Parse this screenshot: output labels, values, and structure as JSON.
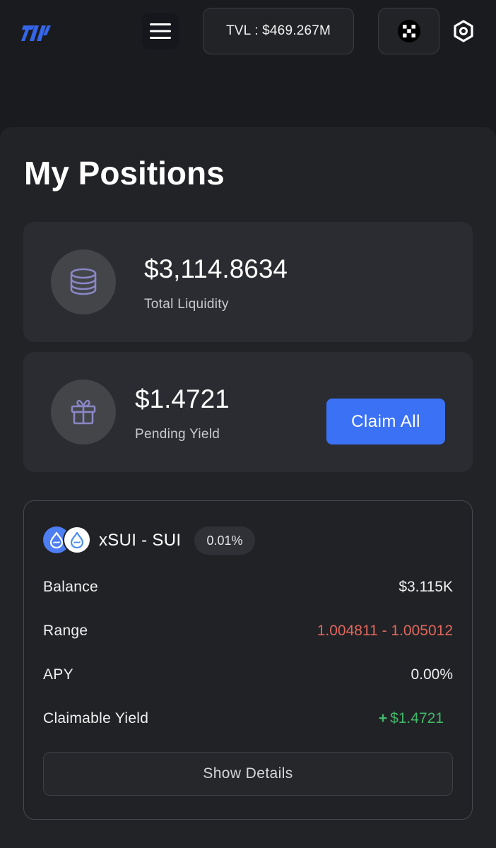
{
  "header": {
    "tvl_label": "TVL : $469.267M"
  },
  "page": {
    "title": "My Positions"
  },
  "liquidity_card": {
    "value": "$3,114.8634",
    "label": "Total Liquidity",
    "icon": "coins-stack-icon"
  },
  "yield_card": {
    "value": "$1.4721",
    "label": "Pending Yield",
    "icon": "gift-icon",
    "claim_label": "Claim All"
  },
  "position": {
    "pair_name": "xSUI - SUI",
    "fee": "0.01%",
    "rows": [
      {
        "label": "Balance",
        "value": "$3.115K"
      },
      {
        "label": "Range",
        "value": "1.004811 - 1.005012"
      },
      {
        "label": "APY",
        "value": "0.00%"
      },
      {
        "label": "Claimable Yield",
        "value": "$1.4721",
        "prefix": "+"
      }
    ],
    "details_label": "Show Details"
  },
  "colors": {
    "background": "#1a1b1f",
    "panel": "#222327",
    "card": "#2b2c31",
    "accent": "#3b71f5",
    "range_red": "#e0675c",
    "yield_green": "#41b868"
  }
}
